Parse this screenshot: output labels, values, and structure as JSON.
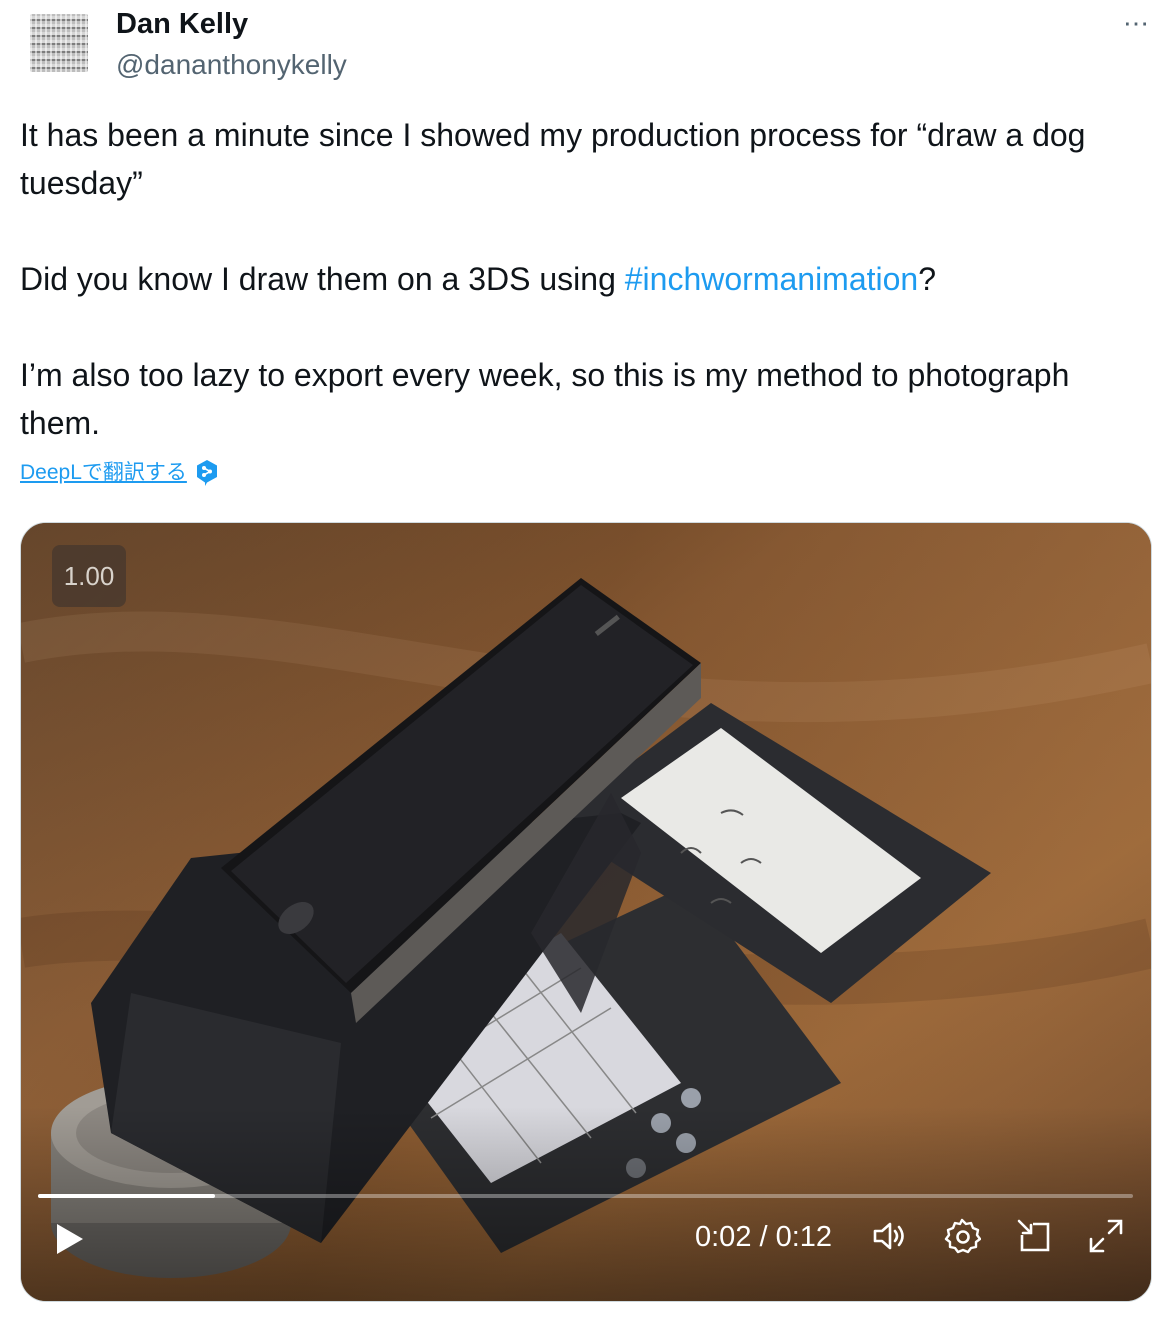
{
  "author": {
    "name": "Dan Kelly",
    "handle": "@dananthonykelly"
  },
  "more_icon": "⋯",
  "tweet": {
    "line1": "It has been a minute since I showed my production process for “draw a dog tuesday”",
    "line2_before": "Did you know I draw them on a 3DS using ",
    "hashtag": "#inchwormanimation",
    "line2_after": "?",
    "line3": "I’m also too lazy to export every week, so this is my method to photograph them."
  },
  "translate": {
    "label": "DeepLで翻訳する",
    "icon": "deepl-icon"
  },
  "video": {
    "speed_badge": "1.00",
    "time": "0:02 / 0:12",
    "progress": 0.162,
    "icons": [
      "play-icon",
      "volume-icon",
      "settings-icon",
      "picture-in-picture-icon",
      "fullscreen-icon"
    ]
  },
  "colors": {
    "accent": "#1d9bf0",
    "text": "#0f1419",
    "secondary": "#536471"
  }
}
